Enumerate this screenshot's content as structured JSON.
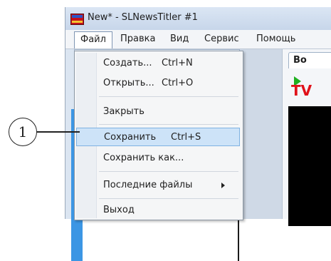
{
  "window": {
    "title": "New* - SLNewsTitler #1"
  },
  "menubar": {
    "items": [
      "Файл",
      "Правка",
      "Вид",
      "Сервис",
      "Помощь"
    ]
  },
  "left_pane": {
    "icons": "&#x2C5; X"
  },
  "right_pane": {
    "tab_label": "Во",
    "tv_label": "TV"
  },
  "file_menu": {
    "items": [
      {
        "label": "Создать...",
        "shortcut": "Ctrl+N"
      },
      {
        "label": "Открыть...",
        "shortcut": "Ctrl+O"
      },
      {
        "label": "Закрыть",
        "shortcut": ""
      },
      {
        "label": "Сохранить",
        "shortcut": "Ctrl+S"
      },
      {
        "label": "Сохранить как...",
        "shortcut": ""
      },
      {
        "label": "Последние файлы",
        "shortcut": ""
      },
      {
        "label": "Выход",
        "shortcut": ""
      }
    ]
  },
  "callout": {
    "number": "1"
  },
  "icons": {
    "pin": "pin-icon",
    "close": "close-icon",
    "app": "app-icon",
    "play": "play-icon",
    "submenu": "submenu-arrow-icon"
  }
}
